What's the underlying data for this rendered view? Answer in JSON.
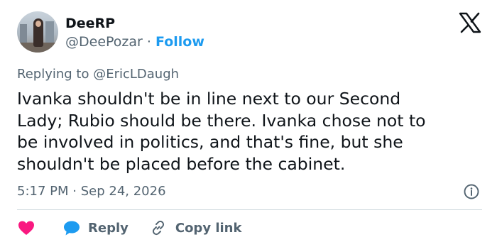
{
  "author": {
    "name": "DeeRP",
    "handle": "@DeePozar",
    "separator": "·",
    "follow_label": "Follow"
  },
  "reply_context": {
    "label": "Replying to",
    "to_handle": "@EricLDaugh"
  },
  "tweet": {
    "text": "Ivanka shouldn't be in line next to our Second\nLady; Rubio should be there.  Ivanka chose not to\nbe involved in politics, and that's fine, but she\nshouldn't be placed before the cabinet."
  },
  "meta": {
    "time": "5:17 PM",
    "separator": "·",
    "date": "Sep 24, 2026"
  },
  "actions": {
    "reply_label": "Reply",
    "copy_link_label": "Copy link"
  },
  "icons": {
    "logo": "x-logo-icon",
    "info": "info-icon",
    "like": "heart-icon",
    "reply": "speech-bubble-icon",
    "copy": "link-icon"
  },
  "colors": {
    "accent": "#1d9bf0",
    "like": "#f91880",
    "secondary_text": "#536471",
    "primary_text": "#0f1419",
    "divider": "#cfd9de"
  }
}
